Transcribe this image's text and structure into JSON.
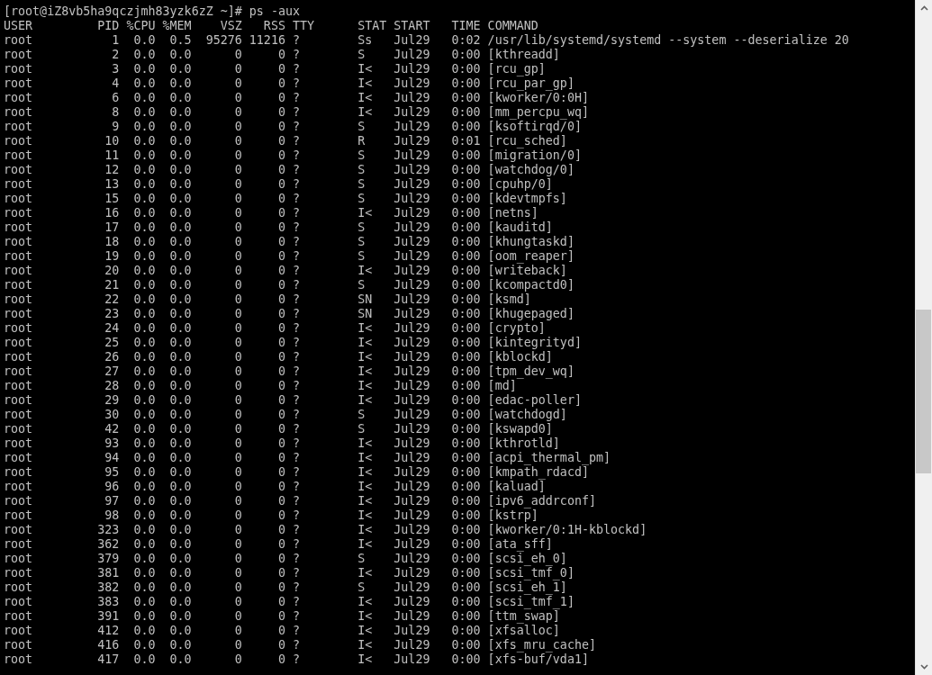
{
  "prompt": "[root@iZ8vb5ha9qczjmh83yzk6zZ ~]# ps -aux",
  "header": [
    "USER",
    "PID",
    "%CPU",
    "%MEM",
    "VSZ",
    "RSS",
    "TTY",
    "STAT",
    "START",
    "TIME",
    "COMMAND"
  ],
  "rows": [
    [
      "root",
      "1",
      "0.0",
      "0.5",
      "95276",
      "11216",
      "?",
      "Ss",
      "Jul29",
      "0:02",
      "/usr/lib/systemd/systemd --system --deserialize 20"
    ],
    [
      "root",
      "2",
      "0.0",
      "0.0",
      "0",
      "0",
      "?",
      "S",
      "Jul29",
      "0:00",
      "[kthreadd]"
    ],
    [
      "root",
      "3",
      "0.0",
      "0.0",
      "0",
      "0",
      "?",
      "I<",
      "Jul29",
      "0:00",
      "[rcu_gp]"
    ],
    [
      "root",
      "4",
      "0.0",
      "0.0",
      "0",
      "0",
      "?",
      "I<",
      "Jul29",
      "0:00",
      "[rcu_par_gp]"
    ],
    [
      "root",
      "6",
      "0.0",
      "0.0",
      "0",
      "0",
      "?",
      "I<",
      "Jul29",
      "0:00",
      "[kworker/0:0H]"
    ],
    [
      "root",
      "8",
      "0.0",
      "0.0",
      "0",
      "0",
      "?",
      "I<",
      "Jul29",
      "0:00",
      "[mm_percpu_wq]"
    ],
    [
      "root",
      "9",
      "0.0",
      "0.0",
      "0",
      "0",
      "?",
      "S",
      "Jul29",
      "0:00",
      "[ksoftirqd/0]"
    ],
    [
      "root",
      "10",
      "0.0",
      "0.0",
      "0",
      "0",
      "?",
      "R",
      "Jul29",
      "0:01",
      "[rcu_sched]"
    ],
    [
      "root",
      "11",
      "0.0",
      "0.0",
      "0",
      "0",
      "?",
      "S",
      "Jul29",
      "0:00",
      "[migration/0]"
    ],
    [
      "root",
      "12",
      "0.0",
      "0.0",
      "0",
      "0",
      "?",
      "S",
      "Jul29",
      "0:00",
      "[watchdog/0]"
    ],
    [
      "root",
      "13",
      "0.0",
      "0.0",
      "0",
      "0",
      "?",
      "S",
      "Jul29",
      "0:00",
      "[cpuhp/0]"
    ],
    [
      "root",
      "15",
      "0.0",
      "0.0",
      "0",
      "0",
      "?",
      "S",
      "Jul29",
      "0:00",
      "[kdevtmpfs]"
    ],
    [
      "root",
      "16",
      "0.0",
      "0.0",
      "0",
      "0",
      "?",
      "I<",
      "Jul29",
      "0:00",
      "[netns]"
    ],
    [
      "root",
      "17",
      "0.0",
      "0.0",
      "0",
      "0",
      "?",
      "S",
      "Jul29",
      "0:00",
      "[kauditd]"
    ],
    [
      "root",
      "18",
      "0.0",
      "0.0",
      "0",
      "0",
      "?",
      "S",
      "Jul29",
      "0:00",
      "[khungtaskd]"
    ],
    [
      "root",
      "19",
      "0.0",
      "0.0",
      "0",
      "0",
      "?",
      "S",
      "Jul29",
      "0:00",
      "[oom_reaper]"
    ],
    [
      "root",
      "20",
      "0.0",
      "0.0",
      "0",
      "0",
      "?",
      "I<",
      "Jul29",
      "0:00",
      "[writeback]"
    ],
    [
      "root",
      "21",
      "0.0",
      "0.0",
      "0",
      "0",
      "?",
      "S",
      "Jul29",
      "0:00",
      "[kcompactd0]"
    ],
    [
      "root",
      "22",
      "0.0",
      "0.0",
      "0",
      "0",
      "?",
      "SN",
      "Jul29",
      "0:00",
      "[ksmd]"
    ],
    [
      "root",
      "23",
      "0.0",
      "0.0",
      "0",
      "0",
      "?",
      "SN",
      "Jul29",
      "0:00",
      "[khugepaged]"
    ],
    [
      "root",
      "24",
      "0.0",
      "0.0",
      "0",
      "0",
      "?",
      "I<",
      "Jul29",
      "0:00",
      "[crypto]"
    ],
    [
      "root",
      "25",
      "0.0",
      "0.0",
      "0",
      "0",
      "?",
      "I<",
      "Jul29",
      "0:00",
      "[kintegrityd]"
    ],
    [
      "root",
      "26",
      "0.0",
      "0.0",
      "0",
      "0",
      "?",
      "I<",
      "Jul29",
      "0:00",
      "[kblockd]"
    ],
    [
      "root",
      "27",
      "0.0",
      "0.0",
      "0",
      "0",
      "?",
      "I<",
      "Jul29",
      "0:00",
      "[tpm_dev_wq]"
    ],
    [
      "root",
      "28",
      "0.0",
      "0.0",
      "0",
      "0",
      "?",
      "I<",
      "Jul29",
      "0:00",
      "[md]"
    ],
    [
      "root",
      "29",
      "0.0",
      "0.0",
      "0",
      "0",
      "?",
      "I<",
      "Jul29",
      "0:00",
      "[edac-poller]"
    ],
    [
      "root",
      "30",
      "0.0",
      "0.0",
      "0",
      "0",
      "?",
      "S",
      "Jul29",
      "0:00",
      "[watchdogd]"
    ],
    [
      "root",
      "42",
      "0.0",
      "0.0",
      "0",
      "0",
      "?",
      "S",
      "Jul29",
      "0:00",
      "[kswapd0]"
    ],
    [
      "root",
      "93",
      "0.0",
      "0.0",
      "0",
      "0",
      "?",
      "I<",
      "Jul29",
      "0:00",
      "[kthrotld]"
    ],
    [
      "root",
      "94",
      "0.0",
      "0.0",
      "0",
      "0",
      "?",
      "I<",
      "Jul29",
      "0:00",
      "[acpi_thermal_pm]"
    ],
    [
      "root",
      "95",
      "0.0",
      "0.0",
      "0",
      "0",
      "?",
      "I<",
      "Jul29",
      "0:00",
      "[kmpath_rdacd]"
    ],
    [
      "root",
      "96",
      "0.0",
      "0.0",
      "0",
      "0",
      "?",
      "I<",
      "Jul29",
      "0:00",
      "[kaluad]"
    ],
    [
      "root",
      "97",
      "0.0",
      "0.0",
      "0",
      "0",
      "?",
      "I<",
      "Jul29",
      "0:00",
      "[ipv6_addrconf]"
    ],
    [
      "root",
      "98",
      "0.0",
      "0.0",
      "0",
      "0",
      "?",
      "I<",
      "Jul29",
      "0:00",
      "[kstrp]"
    ],
    [
      "root",
      "323",
      "0.0",
      "0.0",
      "0",
      "0",
      "?",
      "I<",
      "Jul29",
      "0:00",
      "[kworker/0:1H-kblockd]"
    ],
    [
      "root",
      "362",
      "0.0",
      "0.0",
      "0",
      "0",
      "?",
      "I<",
      "Jul29",
      "0:00",
      "[ata_sff]"
    ],
    [
      "root",
      "379",
      "0.0",
      "0.0",
      "0",
      "0",
      "?",
      "S",
      "Jul29",
      "0:00",
      "[scsi_eh_0]"
    ],
    [
      "root",
      "381",
      "0.0",
      "0.0",
      "0",
      "0",
      "?",
      "I<",
      "Jul29",
      "0:00",
      "[scsi_tmf_0]"
    ],
    [
      "root",
      "382",
      "0.0",
      "0.0",
      "0",
      "0",
      "?",
      "S",
      "Jul29",
      "0:00",
      "[scsi_eh_1]"
    ],
    [
      "root",
      "383",
      "0.0",
      "0.0",
      "0",
      "0",
      "?",
      "I<",
      "Jul29",
      "0:00",
      "[scsi_tmf_1]"
    ],
    [
      "root",
      "391",
      "0.0",
      "0.0",
      "0",
      "0",
      "?",
      "I<",
      "Jul29",
      "0:00",
      "[ttm_swap]"
    ],
    [
      "root",
      "412",
      "0.0",
      "0.0",
      "0",
      "0",
      "?",
      "I<",
      "Jul29",
      "0:00",
      "[xfsalloc]"
    ],
    [
      "root",
      "416",
      "0.0",
      "0.0",
      "0",
      "0",
      "?",
      "I<",
      "Jul29",
      "0:00",
      "[xfs_mru_cache]"
    ],
    [
      "root",
      "417",
      "0.0",
      "0.0",
      "0",
      "0",
      "?",
      "I<",
      "Jul29",
      "0:00",
      "[xfs-buf/vda1]"
    ]
  ]
}
